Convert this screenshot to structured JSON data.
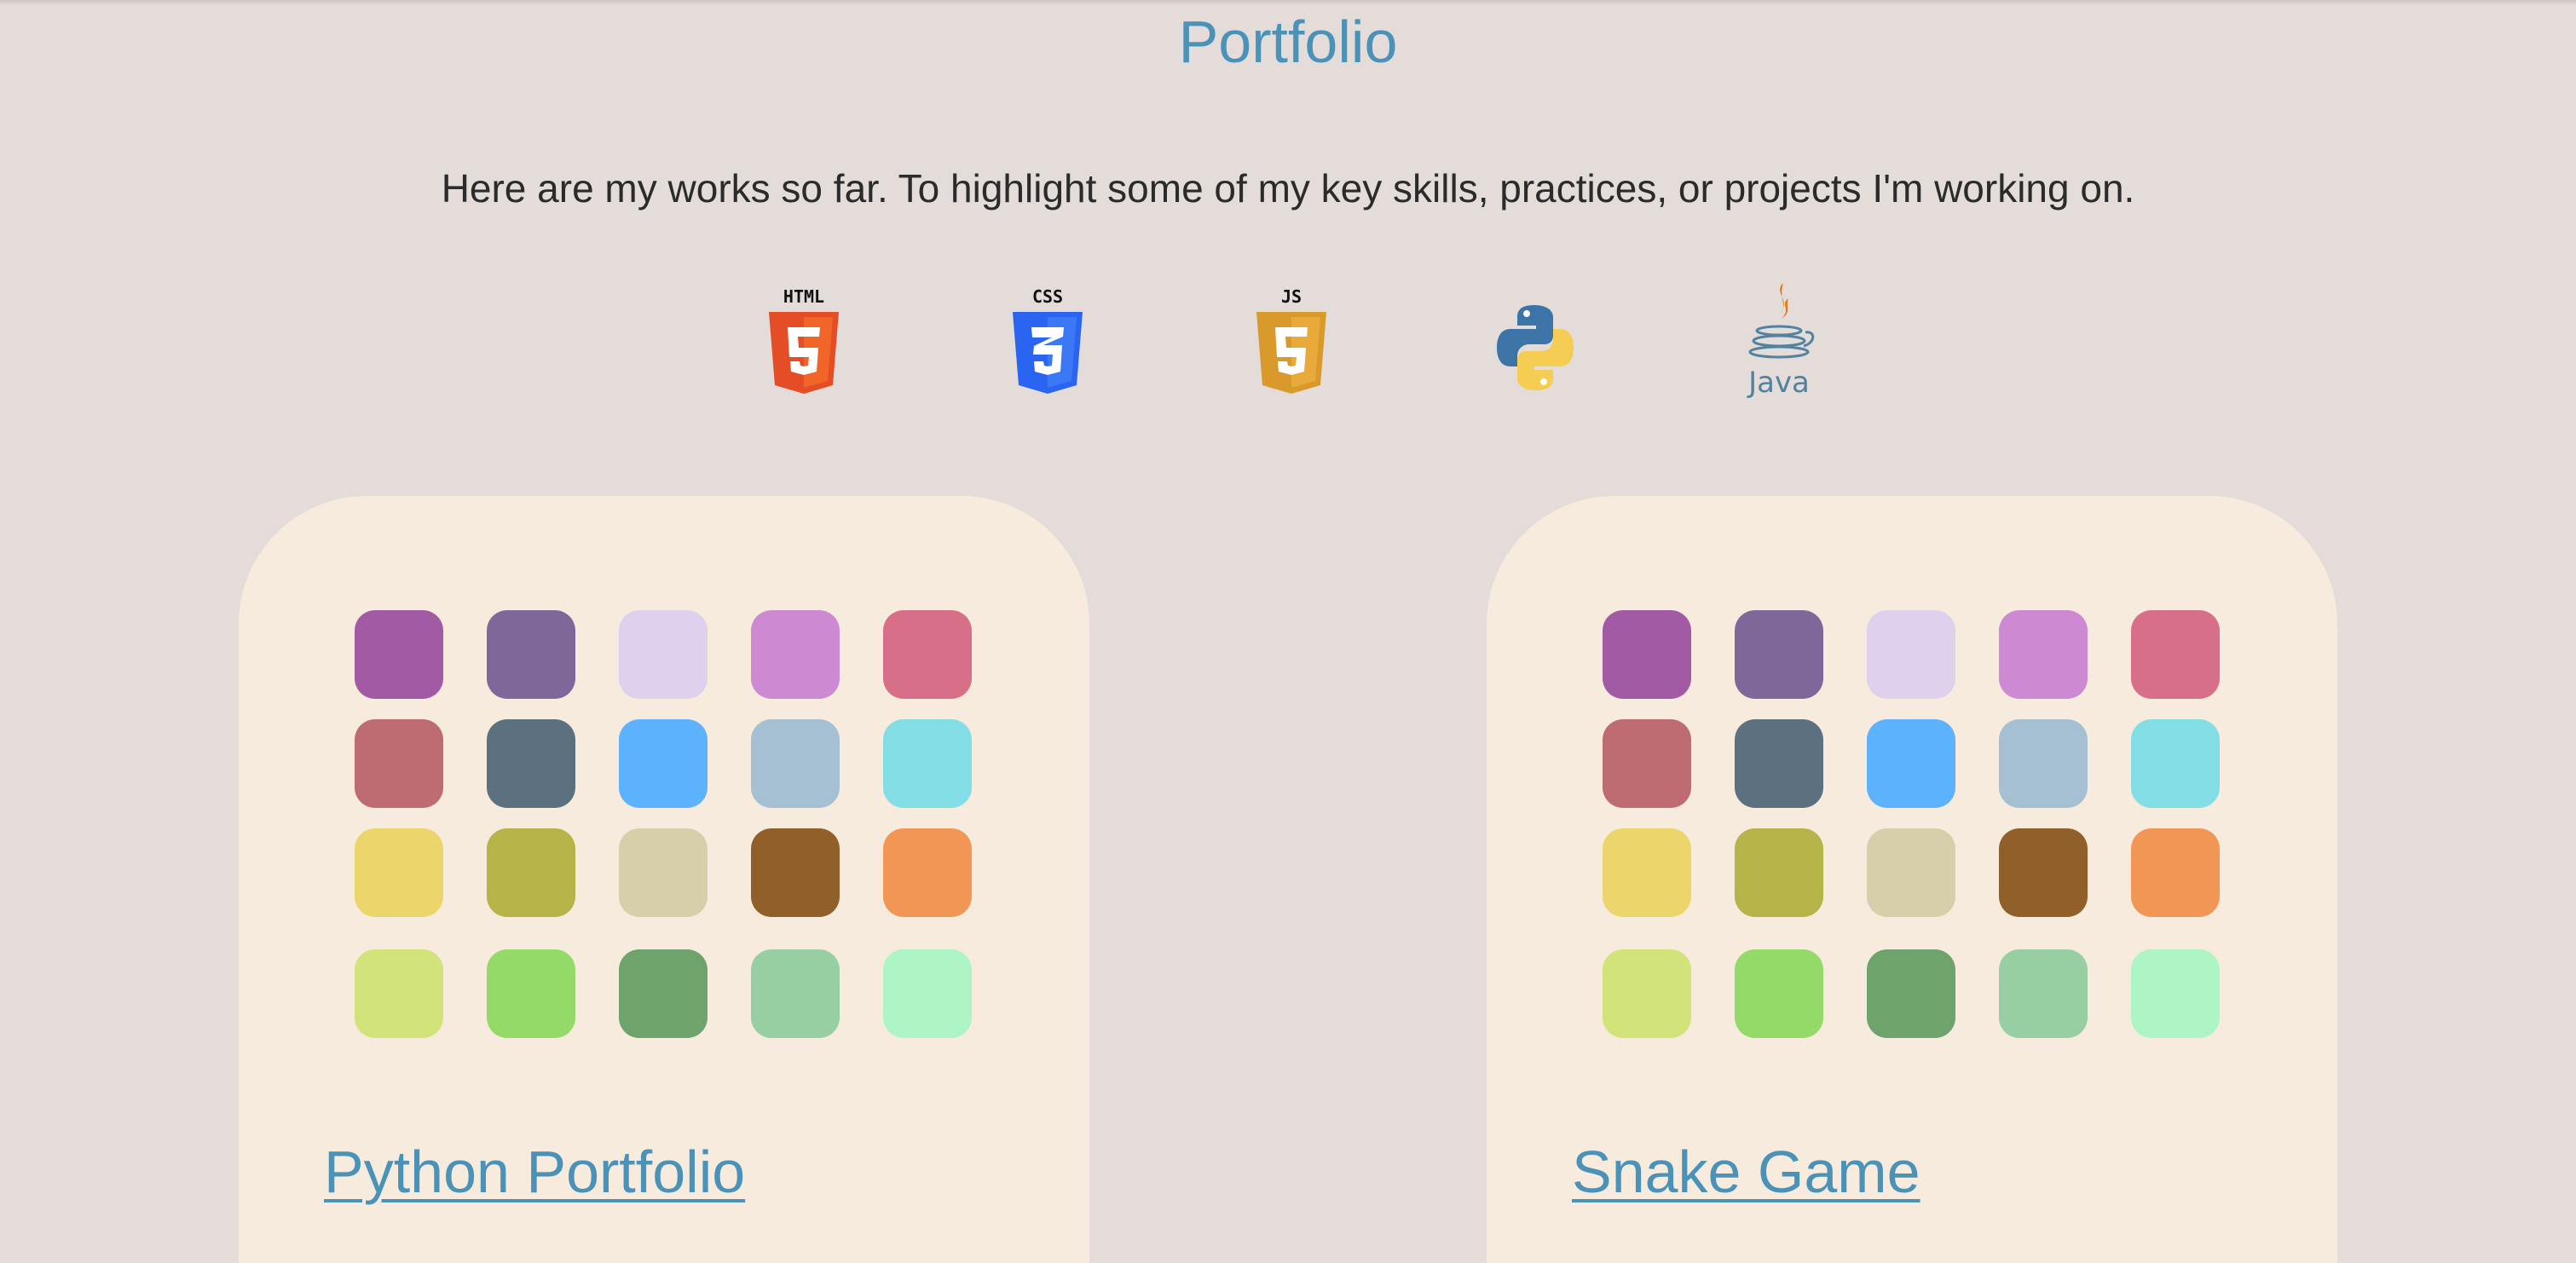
{
  "header": {
    "title": "Portfolio",
    "intro": "Here are my works so far. To highlight some of my key skills, practices, or projects I'm working on."
  },
  "tech_icons": [
    {
      "name": "html5-icon",
      "label": "HTML",
      "color": "#e44d26"
    },
    {
      "name": "css3-icon",
      "label": "CSS",
      "color": "#2965f1"
    },
    {
      "name": "javascript-icon",
      "label": "JS",
      "color": "#e4a124"
    },
    {
      "name": "python-icon",
      "label": "",
      "color": "#3776ab"
    },
    {
      "name": "java-icon",
      "label": "Java",
      "color": "#5382a1"
    }
  ],
  "cards": [
    {
      "link_label": "Python Portfolio"
    },
    {
      "link_label": "Snake Game"
    }
  ],
  "swatch_colors": [
    [
      "#a35aa5",
      "#7f6899",
      "#ded1ee",
      "#cd89d1",
      "#d86f88"
    ],
    [
      "#be6c71",
      "#5c7080",
      "#5db2fd",
      "#a5bfd3",
      "#83dde5"
    ],
    [
      "#ecd66b",
      "#b6b449",
      "#d7ceaa",
      "#915f29",
      "#f29656"
    ],
    [
      "#d2e37a",
      "#93da69",
      "#6ea36c",
      "#98cfa2",
      "#aef5c6"
    ]
  ],
  "theme": {
    "background": "#e3dcd9",
    "card": "#f6ebdc",
    "accent": "#4b92b8"
  }
}
